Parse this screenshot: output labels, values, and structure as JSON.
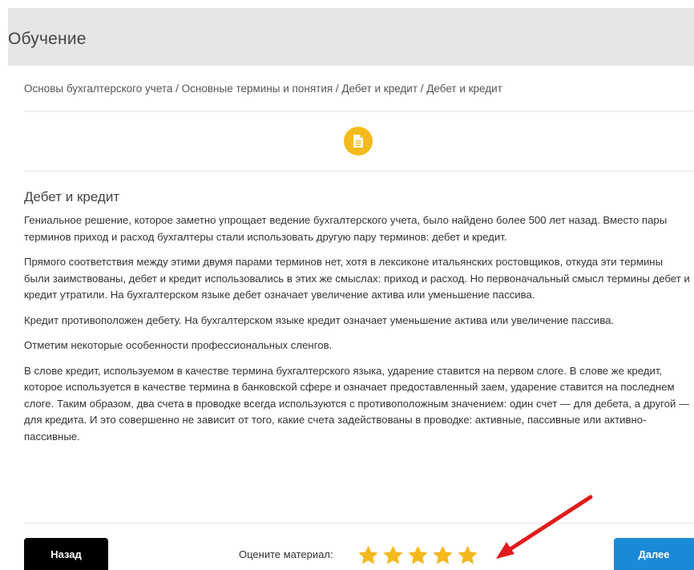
{
  "header": {
    "title": "Обучение"
  },
  "breadcrumb": {
    "text": "Основы бухгалтерского учета / Основные термины и понятия / Дебет и кредит / Дебет и кредит"
  },
  "content": {
    "title": "Дебет и кредит",
    "paragraphs": [
      "Гениальное решение, которое заметно упрощает ведение бухгалтерского учета, было найдено более 500 лет назад. Вместо пары терминов приход и расход бухгалтеры стали использовать другую пару терминов: дебет и кредит.",
      "Прямого соответствия между этими двумя парами терминов нет, хотя в лексиконе итальянских ростовщиков, откуда эти термины были заимствованы, дебет и кредит использовались в этих же смыслах: приход и расход. Но первоначальный смысл термины дебет и кредит утратили. На бухгалтерском языке дебет означает увеличение актива или уменьшение пассива.",
      "Кредит противоположен дебету. На бухгалтерском языке кредит означает уменьшение актива или увеличение пассива.",
      "Отметим некоторые особенности профессиональных сленгов.",
      "В слове кредит, используемом в качестве термина бухгалтерского языка, ударение ставится на первом слоге. В слове же кредит, которое используется в качестве термина в банковской сфере и означает предоставленный заем, ударение ставится на последнем слоге. Таким образом, два счета в проводке всегда используются с противоположным значением: один счет — для дебета, а другой — для кредита. И это совершенно не зависит от того, какие счета задействованы в проводке: активные, пассивные или активно-пассивные."
    ]
  },
  "footer": {
    "back_label": "Назад",
    "next_label": "Далее",
    "rate_label": "Оцените материал:",
    "rating": 5,
    "rating_max": 5
  },
  "icons": {
    "document": "document-icon",
    "star": "star-icon",
    "arrow": "arrow-annotation"
  },
  "colors": {
    "header_bg": "#e6e6e6",
    "badge": "#f5bb1b",
    "star": "#f5b81c",
    "back_button": "#000000",
    "next_button": "#1a8ad6",
    "arrow": "#e01b1b"
  }
}
